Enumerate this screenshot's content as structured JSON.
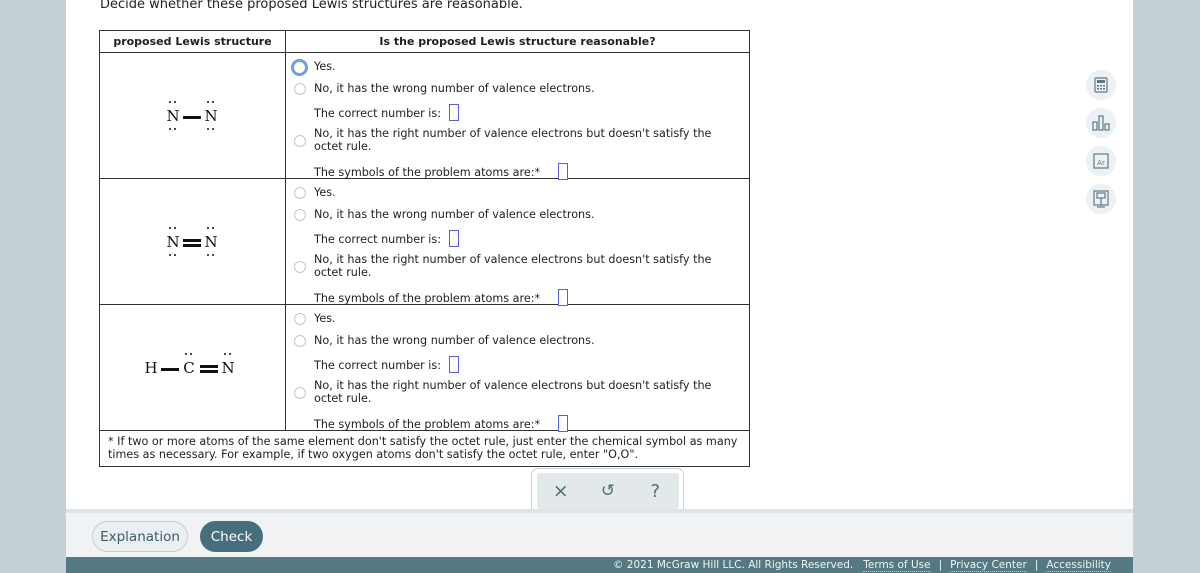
{
  "prompt": "Decide whether these proposed Lewis structures are reasonable.",
  "table": {
    "headers": [
      "proposed Lewis structure",
      "Is the proposed Lewis structure reasonable?"
    ],
    "rows": [
      {
        "structure": {
          "atoms": [
            "N",
            "N"
          ],
          "bonds": [
            "single"
          ],
          "description": "N—N with two lone pairs (top and bottom) on each N"
        },
        "options": {
          "yes": "Yes.",
          "wrong_electrons": "No, it has the wrong number of valence electrons.",
          "correct_number_label": "The correct number is:",
          "correct_number_value": "",
          "octet": "No, it has the right number of valence electrons but doesn't satisfy the octet rule.",
          "problem_atoms_label": "The symbols of the problem atoms are:*",
          "problem_atoms_value": ""
        },
        "selected": "yes"
      },
      {
        "structure": {
          "atoms": [
            "N",
            "N"
          ],
          "bonds": [
            "double"
          ],
          "description": "N=N with two lone pairs (top and bottom) on each N"
        },
        "options": {
          "yes": "Yes.",
          "wrong_electrons": "No, it has the wrong number of valence electrons.",
          "correct_number_label": "The correct number is:",
          "correct_number_value": "",
          "octet": "No, it has the right number of valence electrons but doesn't satisfy the octet rule.",
          "problem_atoms_label": "The symbols of the problem atoms are:*",
          "problem_atoms_value": ""
        },
        "selected": null
      },
      {
        "structure": {
          "atoms": [
            "H",
            "C",
            "N"
          ],
          "bonds": [
            "single",
            "double"
          ],
          "description": "H—C=N with one lone pair on top of C and one on top of N"
        },
        "options": {
          "yes": "Yes.",
          "wrong_electrons": "No, it has the wrong number of valence electrons.",
          "correct_number_label": "The correct number is:",
          "correct_number_value": "",
          "octet": "No, it has the right number of valence electrons but doesn't satisfy the octet rule.",
          "problem_atoms_label": "The symbols of the problem atoms are:*",
          "problem_atoms_value": ""
        },
        "selected": null
      }
    ],
    "footnote": "* If two or more atoms of the same element don't satisfy the octet rule, just enter the chemical symbol as many times as necessary. For example, if two oxygen atoms don't satisfy the octet rule, enter \"O,O\"."
  },
  "tools": {
    "clear": "×",
    "undo": "↺",
    "help": "?"
  },
  "side_tools": [
    "calculator-icon",
    "data-chart-icon",
    "periodic-table-icon",
    "reference-book-icon"
  ],
  "bottom": {
    "explanation_label": "Explanation",
    "check_label": "Check"
  },
  "footer": {
    "copyright": "© 2021 McGraw Hill LLC. All Rights Reserved.",
    "links": [
      "Terms of Use",
      "Privacy Center",
      "Accessibility"
    ]
  },
  "colors": {
    "selected_radio": "#6d9eeb",
    "answer_box": "#5b5be6",
    "check_button": "#476f7b",
    "footer_bg": "#557982",
    "side_bg": "#c4d0d5"
  }
}
